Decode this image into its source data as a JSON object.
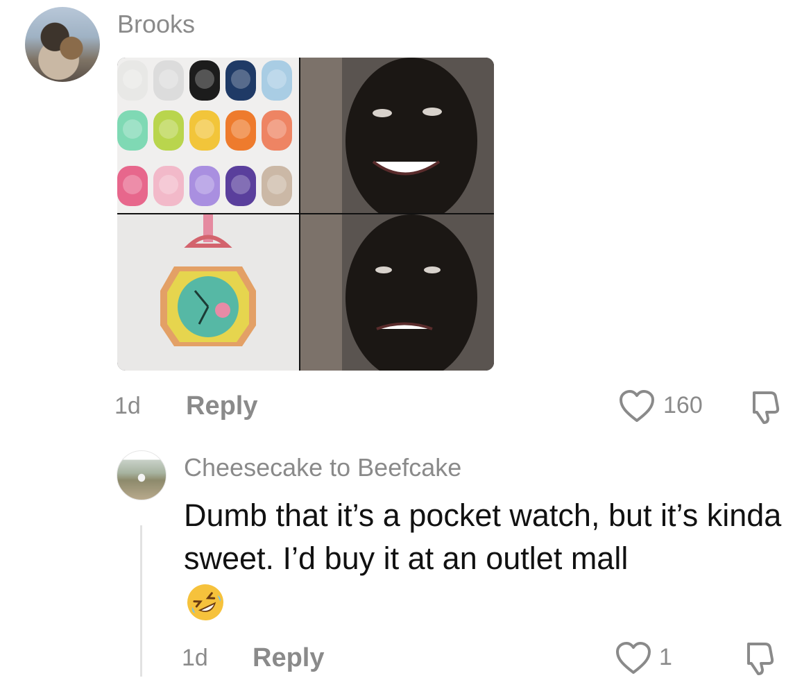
{
  "comments": [
    {
      "username": "Brooks",
      "time": "1d",
      "reply_label": "Reply",
      "likes": "160"
    },
    {
      "username": "Cheesecake to Beefcake",
      "text": "Dumb that it’s a pocket watch, but it’s kinda sweet. I’d buy it at an outlet mall",
      "time": "1d",
      "reply_label": "Reply",
      "likes": "1"
    }
  ],
  "icons": {
    "like": "heart-outline-icon",
    "dislike": "thumbs-down-icon",
    "emoji": "rolling-on-floor-laughing-emoji"
  },
  "colors": {
    "meta_text": "#8a8a8a",
    "body_text": "#111111"
  }
}
